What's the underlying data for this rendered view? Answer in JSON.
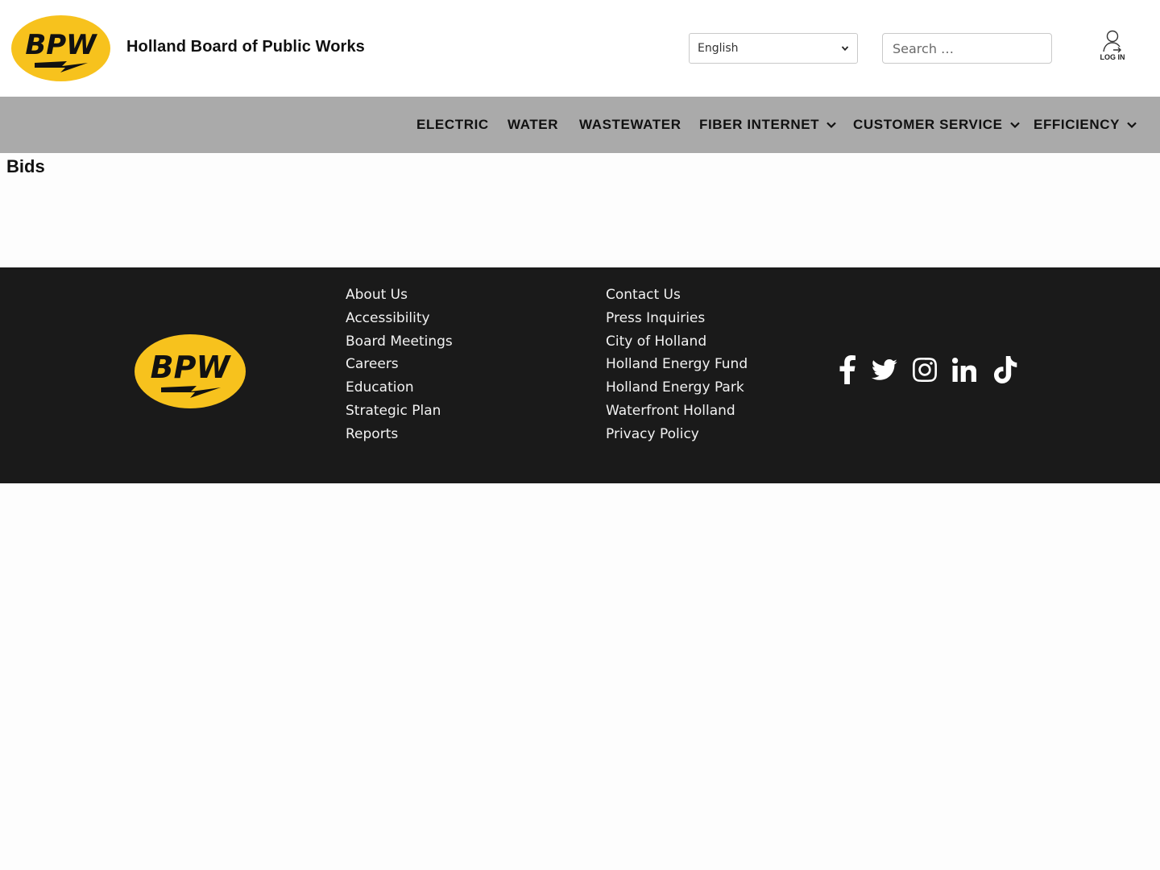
{
  "header": {
    "logo_text": "BPW",
    "site_title": "Holland Board of Public Works",
    "language": {
      "selected": "English"
    },
    "search": {
      "placeholder": "Search …"
    },
    "login_label": "LOG IN"
  },
  "nav": {
    "items": [
      {
        "label": "ELECTRIC",
        "has_dropdown": false
      },
      {
        "label": "WATER",
        "has_dropdown": false
      },
      {
        "label": "WASTEWATER",
        "has_dropdown": false
      },
      {
        "label": "FIBER INTERNET",
        "has_dropdown": true
      },
      {
        "label": "CUSTOMER SERVICE",
        "has_dropdown": true
      },
      {
        "label": "EFFICIENCY",
        "has_dropdown": true
      }
    ]
  },
  "main": {
    "title": "Bids"
  },
  "footer": {
    "logo_text": "BPW",
    "col1": [
      "About Us",
      "Accessibility",
      "Board Meetings",
      "Careers",
      "Education",
      "Strategic Plan",
      "Reports"
    ],
    "col2": [
      "Contact Us",
      "Press Inquiries",
      "City of Holland",
      "Holland Energy Fund",
      "Holland Energy Park",
      "Waterfront Holland",
      "Privacy Policy"
    ],
    "social": [
      "facebook-icon",
      "twitter-icon",
      "instagram-icon",
      "linkedin-icon",
      "tiktok-icon"
    ]
  },
  "colors": {
    "brand_yellow": "#f7c21d",
    "nav_bg": "#aaaaaa",
    "footer_bg": "#1a1a1a"
  }
}
